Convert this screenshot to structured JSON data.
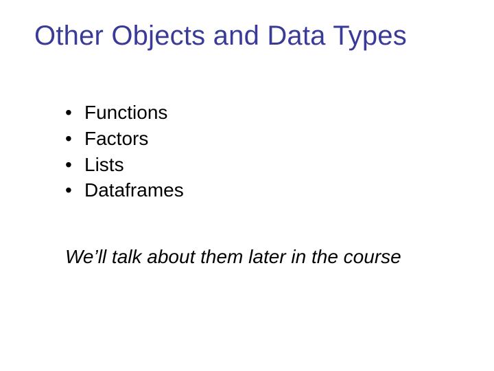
{
  "title": "Other Objects and Data Types",
  "bullets": {
    "items": [
      "Functions",
      "Factors",
      "Lists",
      "Dataframes"
    ]
  },
  "note": "We’ll talk about them later in the course",
  "bullet_glyph": "•"
}
